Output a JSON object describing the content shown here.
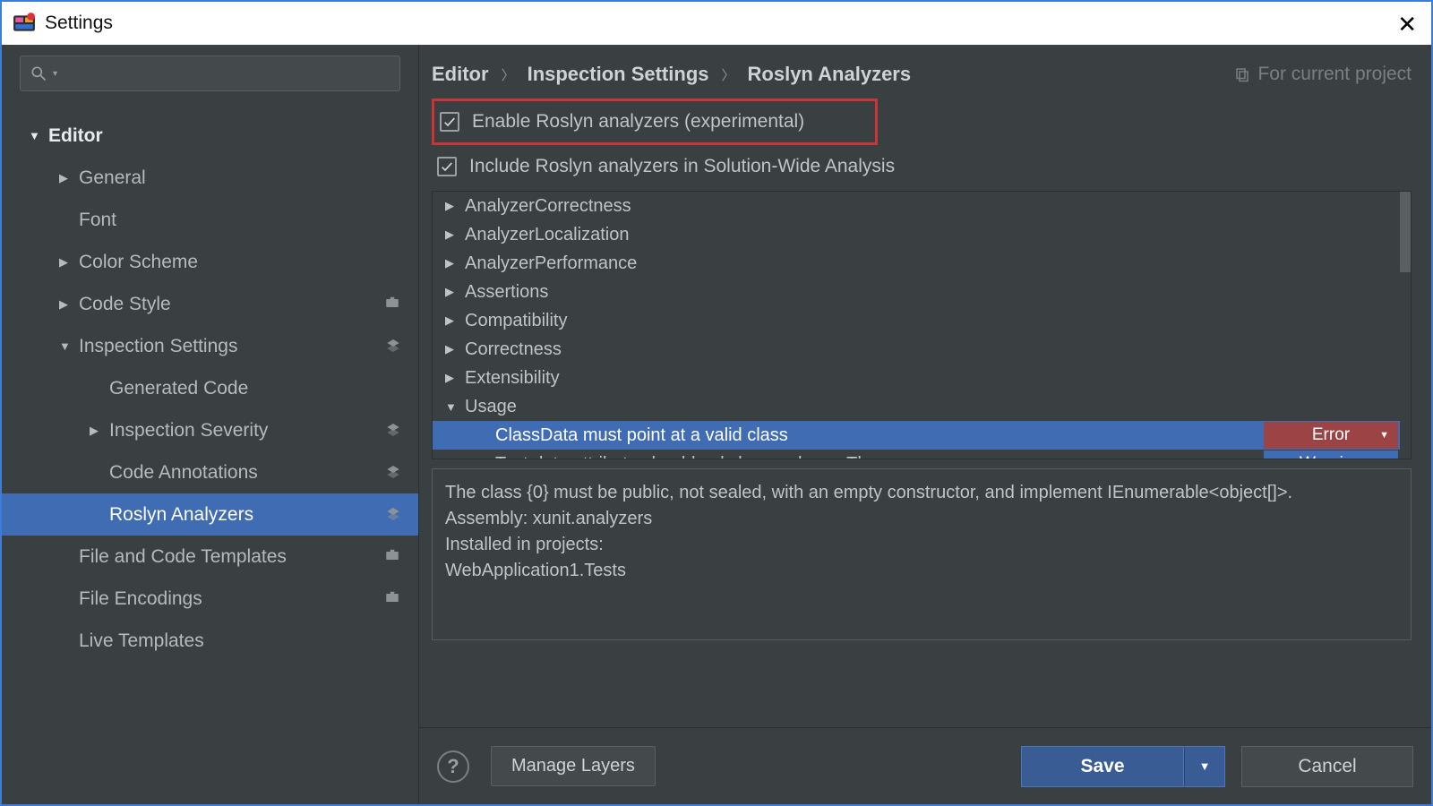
{
  "window": {
    "title": "Settings"
  },
  "sidebar": {
    "items": [
      {
        "label": "Editor",
        "depth": 0,
        "arrow": "down",
        "bold": true,
        "icon": "",
        "selected": false
      },
      {
        "label": "General",
        "depth": 1,
        "arrow": "right",
        "bold": false,
        "icon": "",
        "selected": false
      },
      {
        "label": "Font",
        "depth": 1,
        "arrow": "",
        "bold": false,
        "icon": "",
        "selected": false
      },
      {
        "label": "Color Scheme",
        "depth": 1,
        "arrow": "right",
        "bold": false,
        "icon": "",
        "selected": false
      },
      {
        "label": "Code Style",
        "depth": 1,
        "arrow": "right",
        "bold": false,
        "icon": "briefcase",
        "selected": false
      },
      {
        "label": "Inspection Settings",
        "depth": 1,
        "arrow": "down",
        "bold": false,
        "icon": "layers",
        "selected": false
      },
      {
        "label": "Generated Code",
        "depth": 2,
        "arrow": "",
        "bold": false,
        "icon": "",
        "selected": false
      },
      {
        "label": "Inspection Severity",
        "depth": 2,
        "arrow": "right",
        "bold": false,
        "icon": "layers",
        "selected": false
      },
      {
        "label": "Code Annotations",
        "depth": 2,
        "arrow": "",
        "bold": false,
        "icon": "layers",
        "selected": false
      },
      {
        "label": "Roslyn Analyzers",
        "depth": 2,
        "arrow": "",
        "bold": false,
        "icon": "layers",
        "selected": true
      },
      {
        "label": "File and Code Templates",
        "depth": 1,
        "arrow": "",
        "bold": false,
        "icon": "briefcase",
        "selected": false
      },
      {
        "label": "File Encodings",
        "depth": 1,
        "arrow": "",
        "bold": false,
        "icon": "briefcase",
        "selected": false
      },
      {
        "label": "Live Templates",
        "depth": 1,
        "arrow": "",
        "bold": false,
        "icon": "",
        "selected": false
      }
    ]
  },
  "breadcrumbs": {
    "a": "Editor",
    "b": "Inspection Settings",
    "c": "Roslyn Analyzers",
    "scope": "For current project"
  },
  "checks": {
    "enable": "Enable Roslyn analyzers (experimental)",
    "include": "Include Roslyn analyzers in Solution-Wide Analysis"
  },
  "categories": {
    "items": [
      {
        "label": "AnalyzerCorrectness",
        "arrow": "right",
        "selected": false,
        "indent": 0
      },
      {
        "label": "AnalyzerLocalization",
        "arrow": "right",
        "selected": false,
        "indent": 0
      },
      {
        "label": "AnalyzerPerformance",
        "arrow": "right",
        "selected": false,
        "indent": 0
      },
      {
        "label": "Assertions",
        "arrow": "right",
        "selected": false,
        "indent": 0
      },
      {
        "label": "Compatibility",
        "arrow": "right",
        "selected": false,
        "indent": 0
      },
      {
        "label": "Correctness",
        "arrow": "right",
        "selected": false,
        "indent": 0
      },
      {
        "label": "Extensibility",
        "arrow": "right",
        "selected": false,
        "indent": 0
      },
      {
        "label": "Usage",
        "arrow": "down",
        "selected": false,
        "indent": 0
      },
      {
        "label": "ClassData must point at a valid class",
        "arrow": "",
        "selected": true,
        "indent": 1,
        "severity": "Error",
        "sevclass": "error"
      },
      {
        "label": "Test data attribute should only be used on a Theory",
        "arrow": "",
        "selected": false,
        "indent": 1,
        "severity": "Warning",
        "sevclass": "warning"
      }
    ]
  },
  "description": {
    "l1": "The class {0} must be public, not sealed, with an empty constructor, and implement IEnumerable<object[]>.",
    "l2": "Assembly: xunit.analyzers",
    "l3": "Installed in projects:",
    "l4": " WebApplication1.Tests"
  },
  "buttons": {
    "manage": "Manage Layers",
    "save": "Save",
    "cancel": "Cancel"
  }
}
